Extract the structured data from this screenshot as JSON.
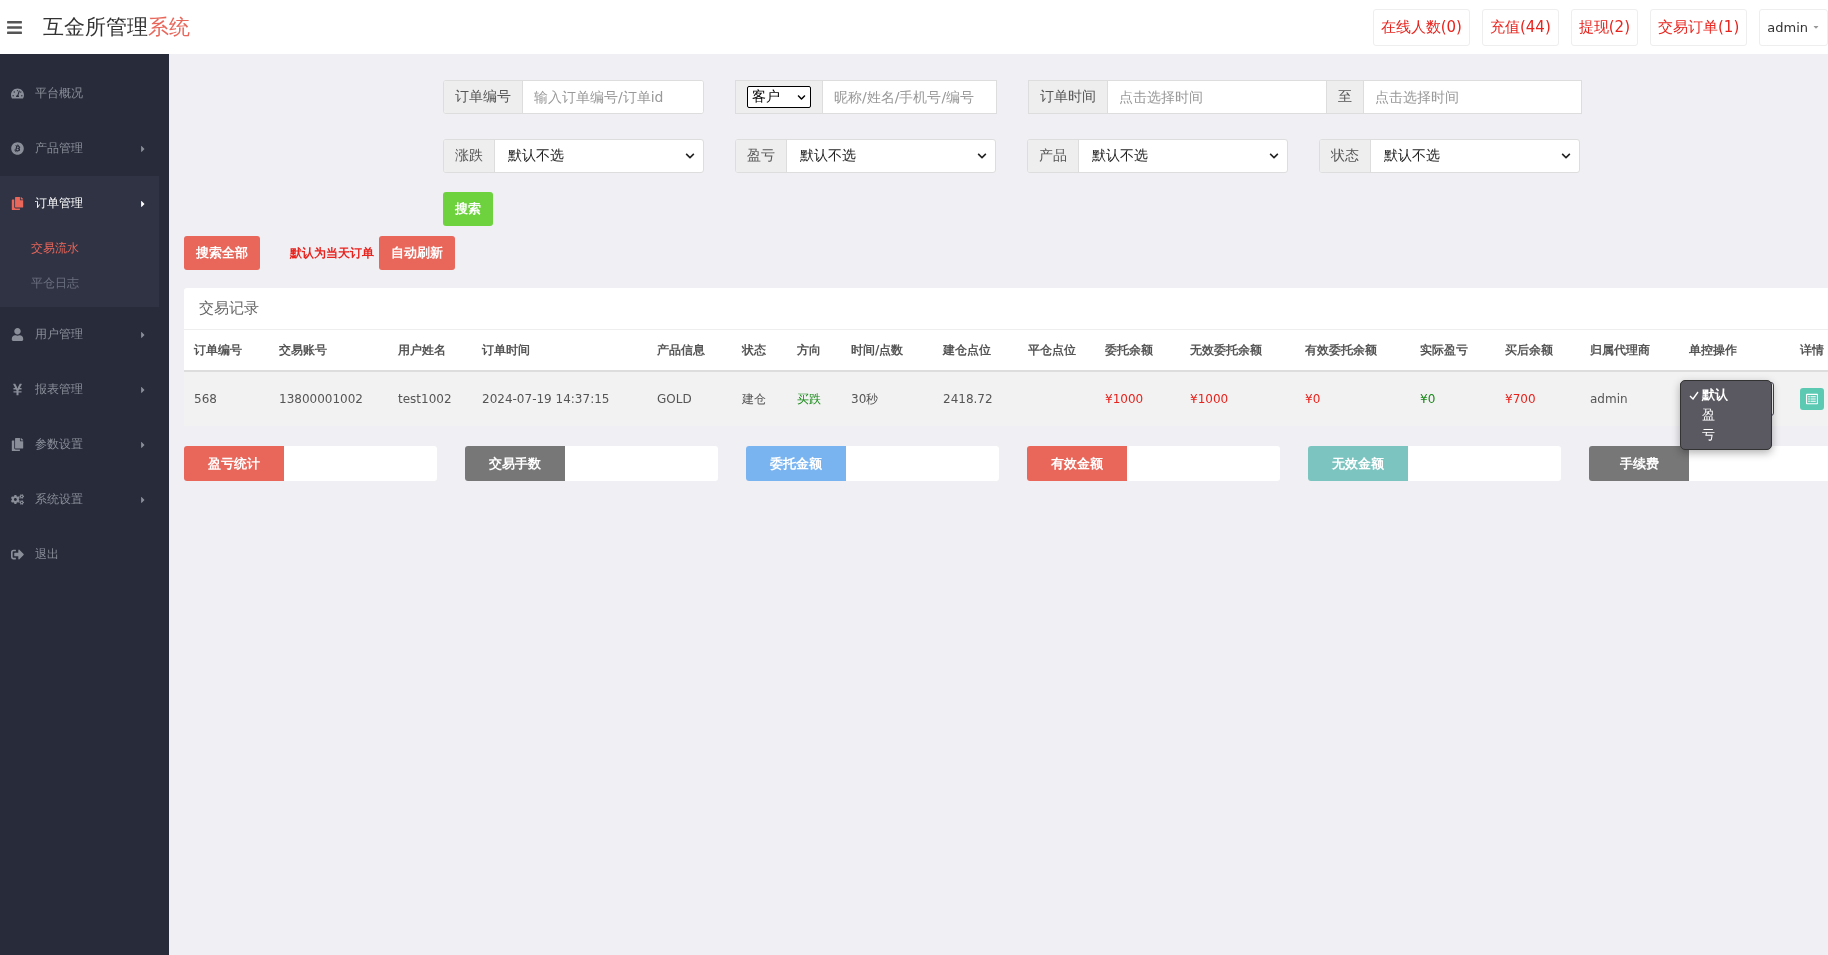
{
  "header": {
    "title": "互金所管理",
    "title_accent": "系统",
    "buttons": [
      {
        "label": "在线人数(0)",
        "kind": "stat"
      },
      {
        "label": "充值(44)",
        "kind": "stat"
      },
      {
        "label": "提现(2)",
        "kind": "stat"
      },
      {
        "label": "交易订单(1)",
        "kind": "stat"
      },
      {
        "label": "admin",
        "kind": "user"
      }
    ]
  },
  "sidebar": {
    "items": [
      {
        "label": "平台概况",
        "kind": "link",
        "expanded": false
      },
      {
        "label": "产品管理",
        "kind": "menu",
        "expanded": false
      },
      {
        "label": "订单管理",
        "kind": "menu",
        "expanded": true,
        "children": [
          {
            "label": "交易流水",
            "selected": true
          },
          {
            "label": "平仓日志",
            "selected": false
          }
        ]
      },
      {
        "label": "用户管理",
        "kind": "menu",
        "expanded": false
      },
      {
        "label": "报表管理",
        "kind": "menu",
        "expanded": false
      },
      {
        "label": "参数设置",
        "kind": "menu",
        "expanded": false
      },
      {
        "label": "系统设置",
        "kind": "menu",
        "expanded": false
      },
      {
        "label": "退出",
        "kind": "link",
        "expanded": false
      }
    ]
  },
  "filters": {
    "rows": [
      [
        {
          "kind": "text",
          "label": "订单编号",
          "placeholder": "输入订单编号/订单id"
        },
        {
          "kind": "select_text",
          "select_value": "客户",
          "placeholder": "昵称/姓名/手机号/编号"
        },
        {
          "kind": "range",
          "label": "订单时间",
          "placeholder": "点击选择时间",
          "separator": "至",
          "placeholder_end": "点击选择时间"
        }
      ],
      [
        {
          "kind": "select",
          "label": "涨跌",
          "value": "默认不选"
        },
        {
          "kind": "select",
          "label": "盈亏",
          "value": "默认不选"
        },
        {
          "kind": "select",
          "label": "产品",
          "value": "默认不选"
        },
        {
          "kind": "select",
          "label": "状态",
          "value": "默认不选"
        }
      ]
    ],
    "search_button": "搜索"
  },
  "actions": {
    "search_all": "搜索全部",
    "note": "默认为当天订单",
    "auto_refresh": "自动刷新"
  },
  "table": {
    "title": "交易记录",
    "columns": [
      "订单编号",
      "交易账号",
      "用户姓名",
      "订单时间",
      "产品信息",
      "状态",
      "方向",
      "时间/点数",
      "建仓点位",
      "平仓点位",
      "委托余额",
      "无效委托余额",
      "有效委托余额",
      "实际盈亏",
      "买后余额",
      "归属代理商",
      "单控操作",
      "详情"
    ],
    "rows": [
      {
        "cells": [
          {
            "text": "568",
            "kind": "plain"
          },
          {
            "text": "13800001002",
            "kind": "plain"
          },
          {
            "text": "test1002",
            "kind": "plain"
          },
          {
            "text": "2024-07-19 14:37:15",
            "kind": "plain"
          },
          {
            "text": "GOLD",
            "kind": "plain"
          },
          {
            "text": "建仓",
            "kind": "plain"
          },
          {
            "text": "买跌",
            "kind": "gain"
          },
          {
            "text": "30秒",
            "kind": "plain"
          },
          {
            "text": "2418.72",
            "kind": "plain"
          },
          {
            "kind": "empty"
          },
          {
            "text": "¥1000",
            "kind": "loss"
          },
          {
            "text": "¥1000",
            "kind": "loss"
          },
          {
            "text": "¥0",
            "kind": "loss"
          },
          {
            "text": "¥0",
            "kind": "gain"
          },
          {
            "text": "¥700",
            "kind": "loss"
          },
          {
            "text": "admin",
            "kind": "plain"
          }
        ],
        "control": {
          "expanded": true,
          "options": [
            {
              "label": "默认",
              "selected": true
            },
            {
              "label": "盈",
              "selected": false
            },
            {
              "label": "亏",
              "selected": false
            }
          ]
        }
      }
    ]
  },
  "summary": [
    {
      "label": "盈亏统计",
      "color": "#e8665a"
    },
    {
      "label": "交易手数",
      "color": "#777777"
    },
    {
      "label": "委托金额",
      "color": "#7ab4f0"
    },
    {
      "label": "有效金额",
      "color": "#e8665a"
    },
    {
      "label": "无效金额",
      "color": "#7cc4c0"
    },
    {
      "label": "手续费",
      "color": "#777777"
    }
  ]
}
